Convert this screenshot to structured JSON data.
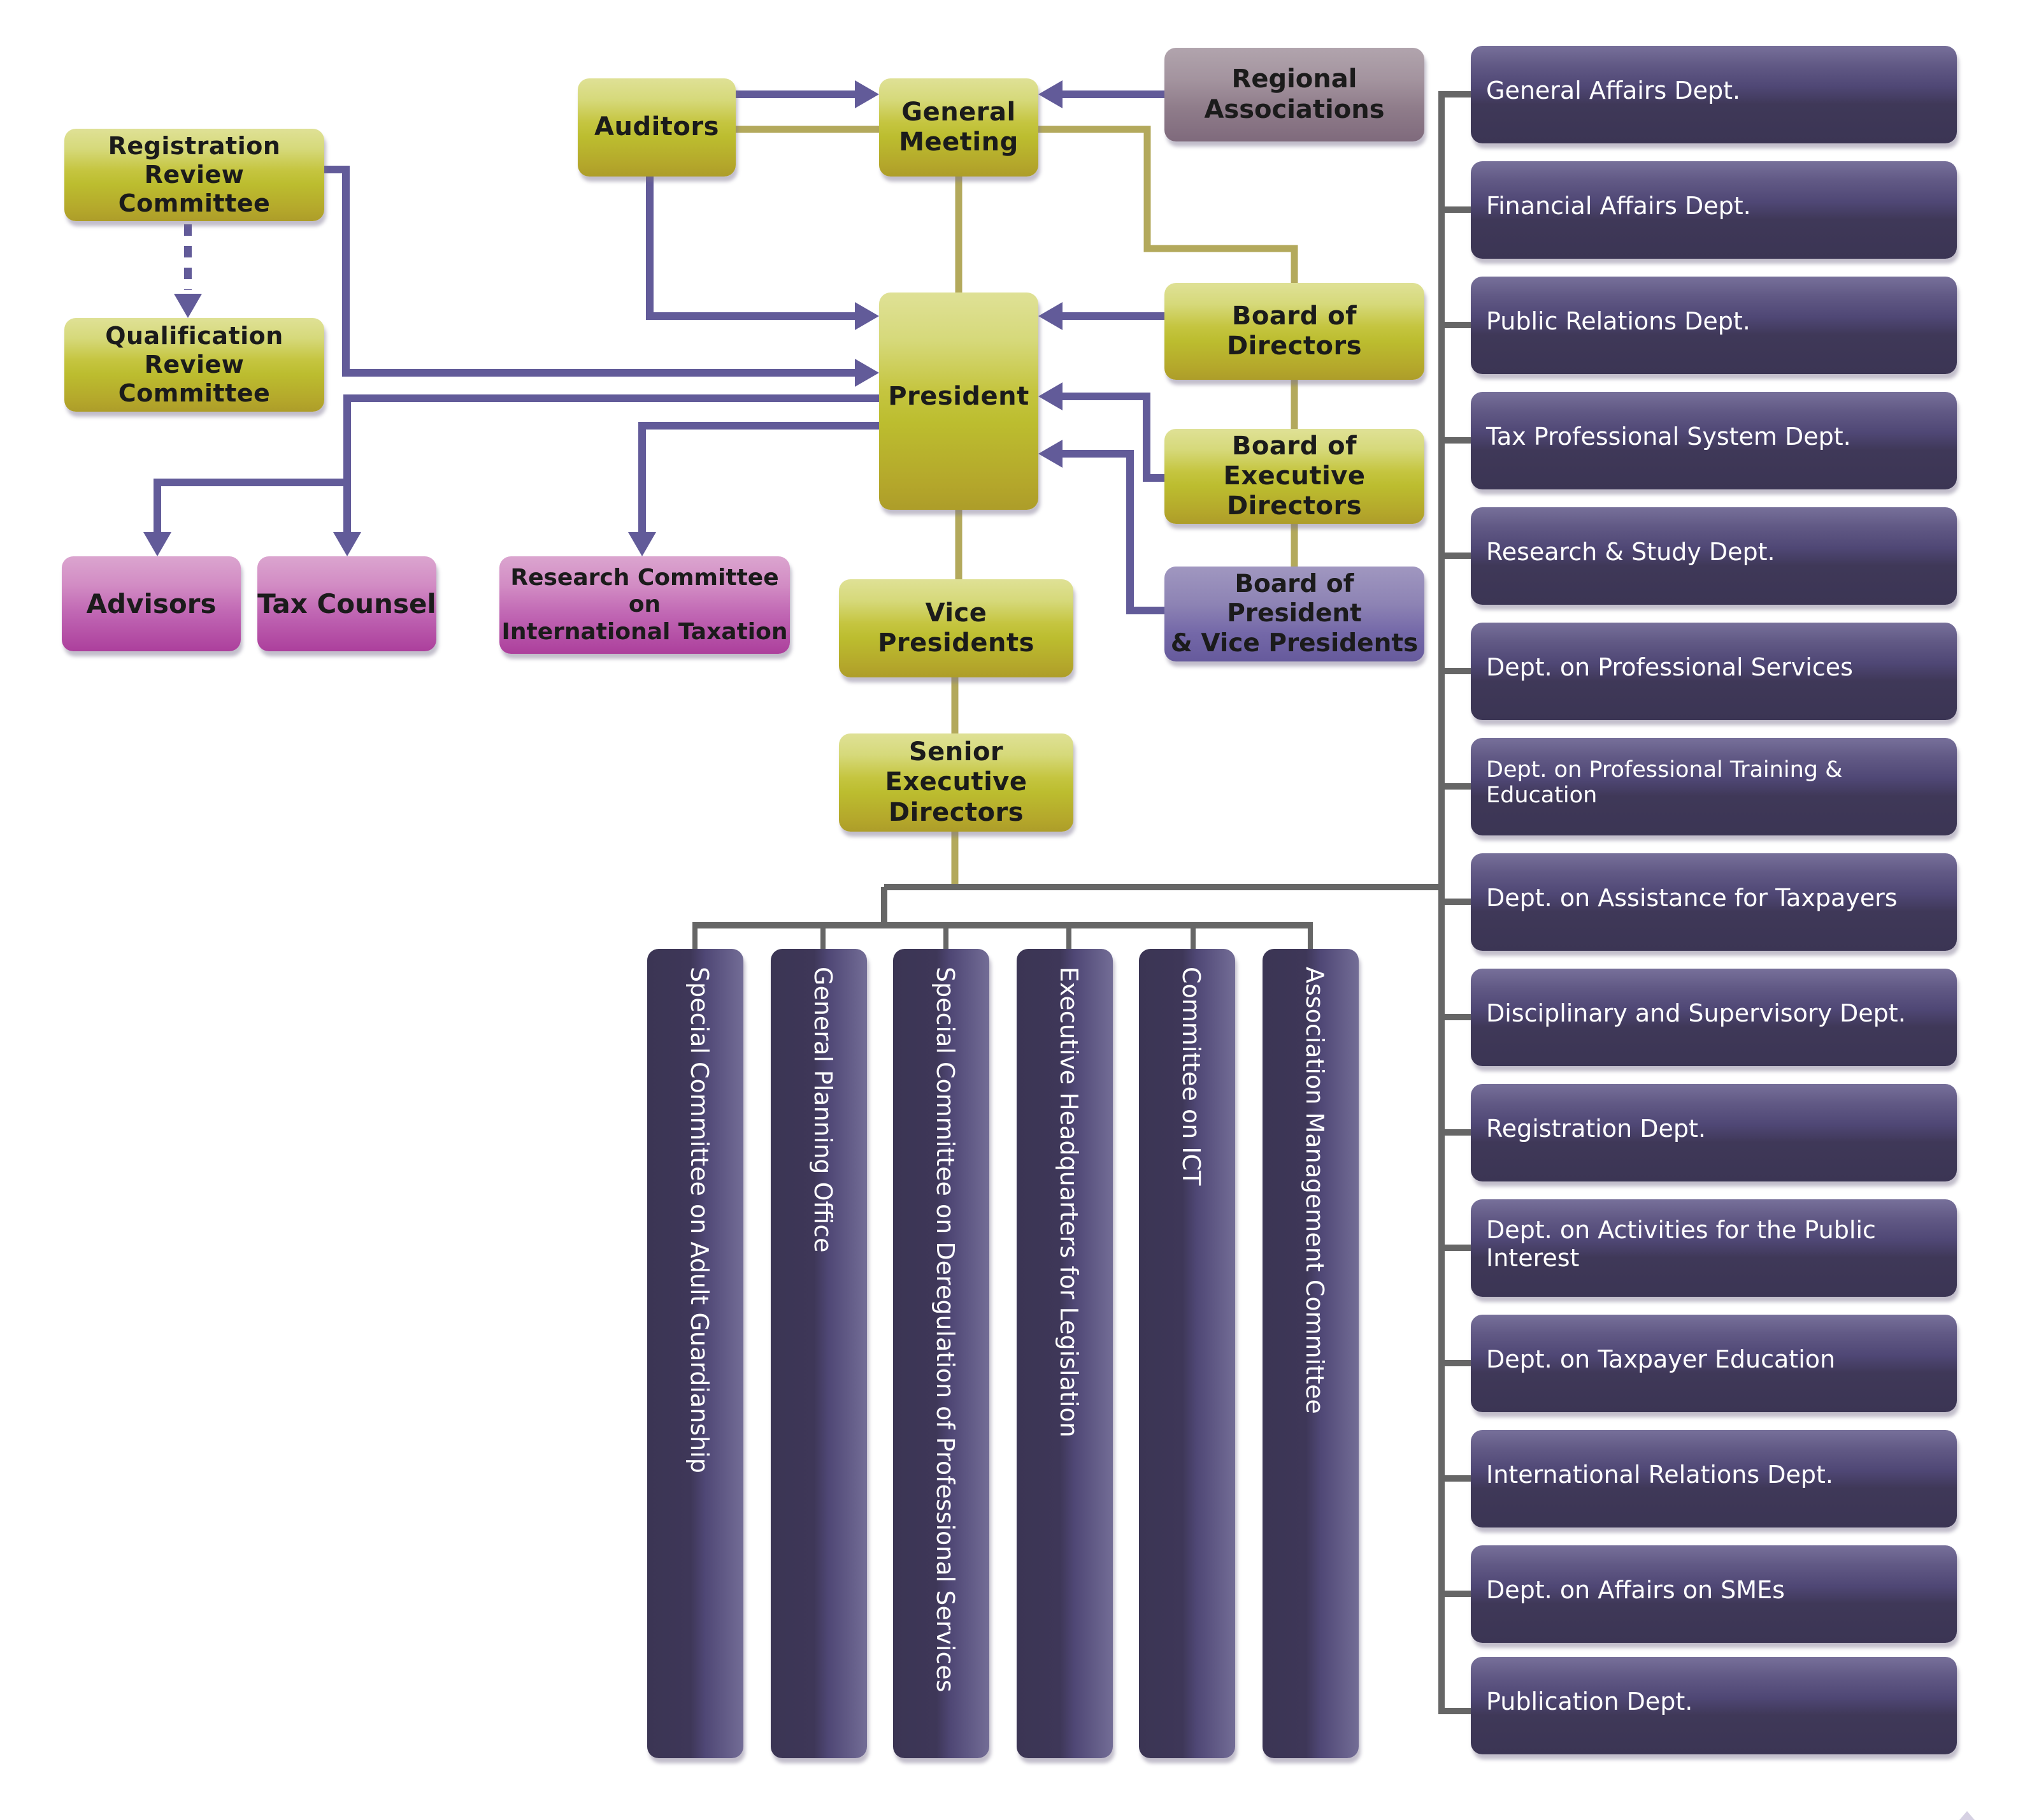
{
  "colors": {
    "authority_line": "#625b99",
    "governance_line": "#b3a95c",
    "branch_line": "#666666",
    "olive_box": "#c5c540",
    "pink_box": "#c066b3",
    "mauve_box": "#8f7c8a",
    "lavender_box": "#7468a8",
    "dept_box": "#3f3858"
  },
  "top_nodes": {
    "auditors": "Auditors",
    "general_meeting": [
      "General",
      "Meeting"
    ],
    "regional_associations": [
      "Regional",
      "Associations"
    ],
    "president": "President",
    "board_of_directors": [
      "Board of",
      "Directors"
    ],
    "board_of_executive_directors": [
      "Board of",
      "Executive Directors"
    ],
    "board_of_president_vp": [
      "Board of President",
      "& Vice Presidents"
    ],
    "vice_presidents": [
      "Vice",
      "Presidents"
    ],
    "senior_executive_directors": [
      "Senior Executive",
      "Directors"
    ]
  },
  "left_nodes": {
    "registration_review_committee": [
      "Registration Review",
      "Committee"
    ],
    "qualification_review_committee": [
      "Qualification Review",
      "Committee"
    ],
    "advisors": "Advisors",
    "tax_counsel": "Tax Counsel",
    "research_committee": [
      "Research Committee on",
      "International Taxation"
    ]
  },
  "bottom_units": [
    "Special Committee on Adult Guardianship",
    "General Planning Office",
    "Special Committee on Deregulation of Professional Services",
    "Executive Headquarters for Legislation",
    "Committee on ICT",
    "Association Management Committee"
  ],
  "departments": [
    "General Affairs Dept.",
    "Financial Affairs Dept.",
    "Public Relations Dept.",
    "Tax Professional System Dept.",
    "Research & Study Dept.",
    "Dept. on Professional Services",
    "Dept. on Professional Training & Education",
    "Dept. on Assistance for Taxpayers",
    "Disciplinary and Supervisory Dept.",
    "Registration Dept.",
    "Dept. on Activities for the Public Interest",
    "Dept. on Taxpayer Education",
    "International Relations Dept.",
    "Dept. on Affairs on SMEs",
    "Publication Dept."
  ]
}
